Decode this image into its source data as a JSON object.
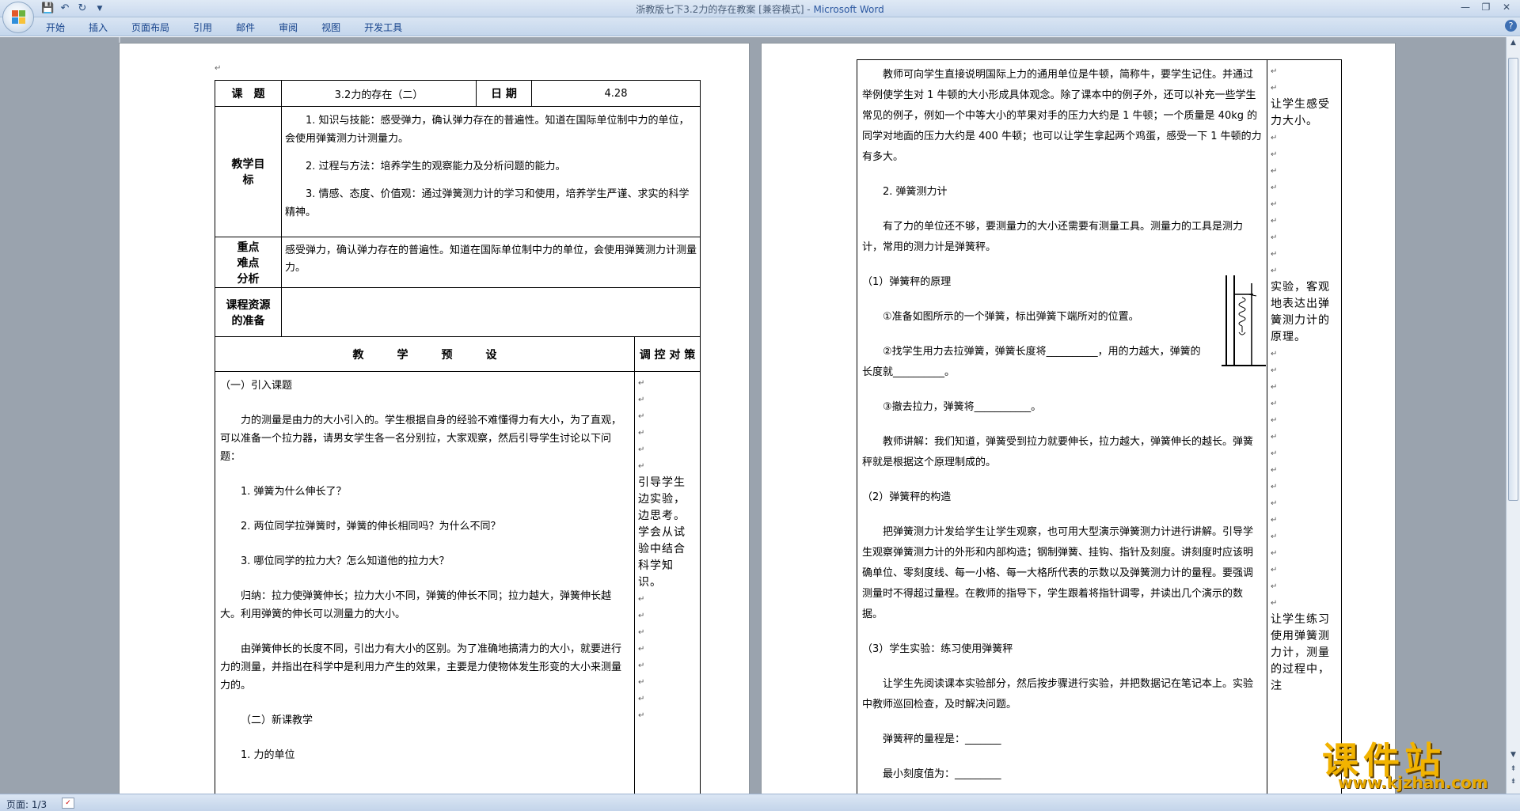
{
  "window": {
    "title_prefix": "浙教版七下3.2力的存在教案 [兼容模式] - ",
    "title_app": "Microsoft Word"
  },
  "ribbon": {
    "tabs": [
      "开始",
      "插入",
      "页面布局",
      "引用",
      "邮件",
      "审阅",
      "视图",
      "开发工具"
    ]
  },
  "left_page": {
    "course_label": "课　题",
    "course_value": "3.2力的存在（二）",
    "date_label": "日 期",
    "date_value": "4.28",
    "goals_label": "教学目标",
    "goals": [
      "1. 知识与技能：感受弹力，确认弹力存在的普遍性。知道在国际单位制中力的单位，会使用弹簧测力计测量力。",
      "2. 过程与方法：培养学生的观察能力及分析问题的能力。",
      "3. 情感、态度、价值观：通过弹簧测力计的学习和使用，培养学生严谨、求实的科学精神。"
    ],
    "key_label": "重点难点分析",
    "key_text": "感受弹力，确认弹力存在的普遍性。知道在国际单位制中力的单位，会使用弹簧测力计测量力。",
    "resources_label": "课程资源的准备",
    "plan_header": "教　　　学　　　预　　　设",
    "control_header": "调 控 对 策",
    "paragraphs": [
      "（一）引入课题",
      "力的测量是由力的大小引入的。学生根据自身的经验不难懂得力有大小，为了直观，可以准备一个拉力器，请男女学生各一名分别拉，大家观察，然后引导学生讨论以下问题：",
      "1. 弹簧为什么伸长了？",
      "2. 两位同学拉弹簧时，弹簧的伸长相同吗？为什么不同？",
      "3. 哪位同学的拉力大？怎么知道他的拉力大？",
      "归纳：拉力使弹簧伸长；拉力大小不同，弹簧的伸长不同；拉力越大，弹簧伸长越大。利用弹簧的伸长可以测量力的大小。",
      "由弹簧伸长的长度不同，引出力有大小的区别。为了准确地搞清力的大小，就要进行力的测量，并指出在科学中是利用力产生的效果，主要是力使物体发生形变的大小来测量力的。",
      "（二）新课教学",
      "1. 力的单位"
    ],
    "side_note": "引导学生边实验，边思考。学会从试验中结合科学知识。"
  },
  "right_page": {
    "paragraphs": [
      "教师可向学生直接说明国际上力的通用单位是牛顿，简称牛，要学生记住。并通过举例使学生对 1 牛顿的大小形成具体观念。除了课本中的例子外，还可以补充一些学生常见的例子，例如一个中等大小的苹果对手的压力大约是 1 牛顿；一个质量是 40kg 的同学对地面的压力大约是 400 牛顿；也可以让学生拿起两个鸡蛋，感受一下 1 牛顿的力有多大。",
      "2. 弹簧测力计",
      "有了力的单位还不够，要测量力的大小还需要有测量工具。测量力的工具是测力计，常用的测力计是弹簧秤。",
      "（1）弹簧秤的原理",
      "①准备如图所示的一个弹簧，标出弹簧下端所对的位置。",
      "②找学生用力去拉弹簧，弹簧长度将__________，用的力越大，弹簧的长度就__________。",
      "③撤去拉力，弹簧将___________。",
      "教师讲解：我们知道，弹簧受到拉力就要伸长，拉力越大，弹簧伸长的越长。弹簧秤就是根据这个原理制成的。",
      "（2）弹簧秤的构造",
      "把弹簧测力计发给学生让学生观察，也可用大型演示弹簧测力计进行讲解。引导学生观察弹簧测力计的外形和内部构造；钢制弹簧、挂钩、指针及刻度。讲刻度时应该明确单位、零刻度线、每一小格、每一大格所代表的示数以及弹簧测力计的量程。要强调测量时不得超过量程。在教师的指导下，学生跟着将指针调零，并读出几个演示的数据。",
      "（3）学生实验：练习使用弹簧秤",
      "让学生先阅读课本实验部分，然后按步骤进行实验，并把数据记在笔记本上。实验中教师巡回检查，及时解决问题。",
      "弹簧秤的量程是：_______",
      "最小刻度值为：_________"
    ],
    "side_notes": [
      "让学生感受力大小。",
      "实验，客观地表达出弹簧测力计的原理。",
      "让学生练习使用弹簧测力计，测量的过程中，注"
    ]
  },
  "statusbar": {
    "page_info": "页面: 1/3"
  },
  "watermark": {
    "logo_text": "课件站",
    "logo_url": "www.kjzhan.com"
  }
}
